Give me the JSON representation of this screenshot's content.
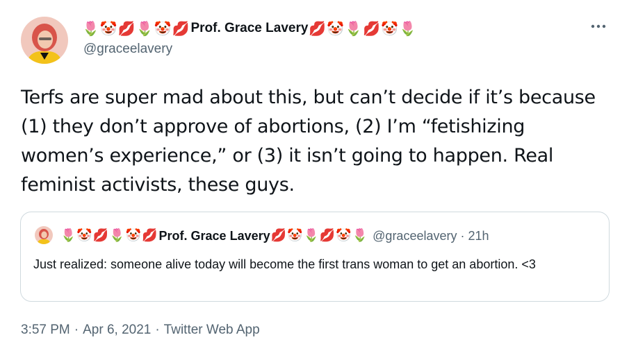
{
  "author": {
    "name_prefix_emoji": [
      "🌷",
      "🤡",
      "💋",
      "🌷",
      "🤡",
      "💋"
    ],
    "name": "Prof. Grace Lavery",
    "name_suffix_emoji": [
      "💋",
      "🤡",
      "🌷",
      "💋",
      "🤡",
      "🌷"
    ],
    "handle": "@graceelavery"
  },
  "more_icon": "more-dots-icon",
  "tweet": {
    "text": "Terfs are super mad about this, but can’t decide if it’s because (1) they don’t approve of abortions, (2) I’m “fetishizing women’s experience,” or (3) it isn’t going to happen. Real feminist activists, these guys."
  },
  "quote": {
    "name_prefix_emoji": [
      "🌷",
      "🤡",
      "💋",
      "🌷",
      "🤡",
      "💋"
    ],
    "name": "Prof. Grace Lavery",
    "name_suffix_emoji": [
      "💋",
      "🤡",
      "🌷",
      "💋",
      "🤡",
      "🌷"
    ],
    "handle": "@graceelavery",
    "separator": "·",
    "time": "21h",
    "text": "Just realized: someone alive today will become the first trans woman to get an abortion. <3"
  },
  "footer": {
    "time": "3:57 PM",
    "separator": "·",
    "date": "Apr 6, 2021",
    "source": "Twitter Web App"
  },
  "colors": {
    "text": "#0f1419",
    "secondary": "#536471",
    "border": "#cfd9de",
    "avatar_bg": "#f0b7a4",
    "avatar_hair": "#d9534f",
    "avatar_jacket": "#f3c21a"
  }
}
